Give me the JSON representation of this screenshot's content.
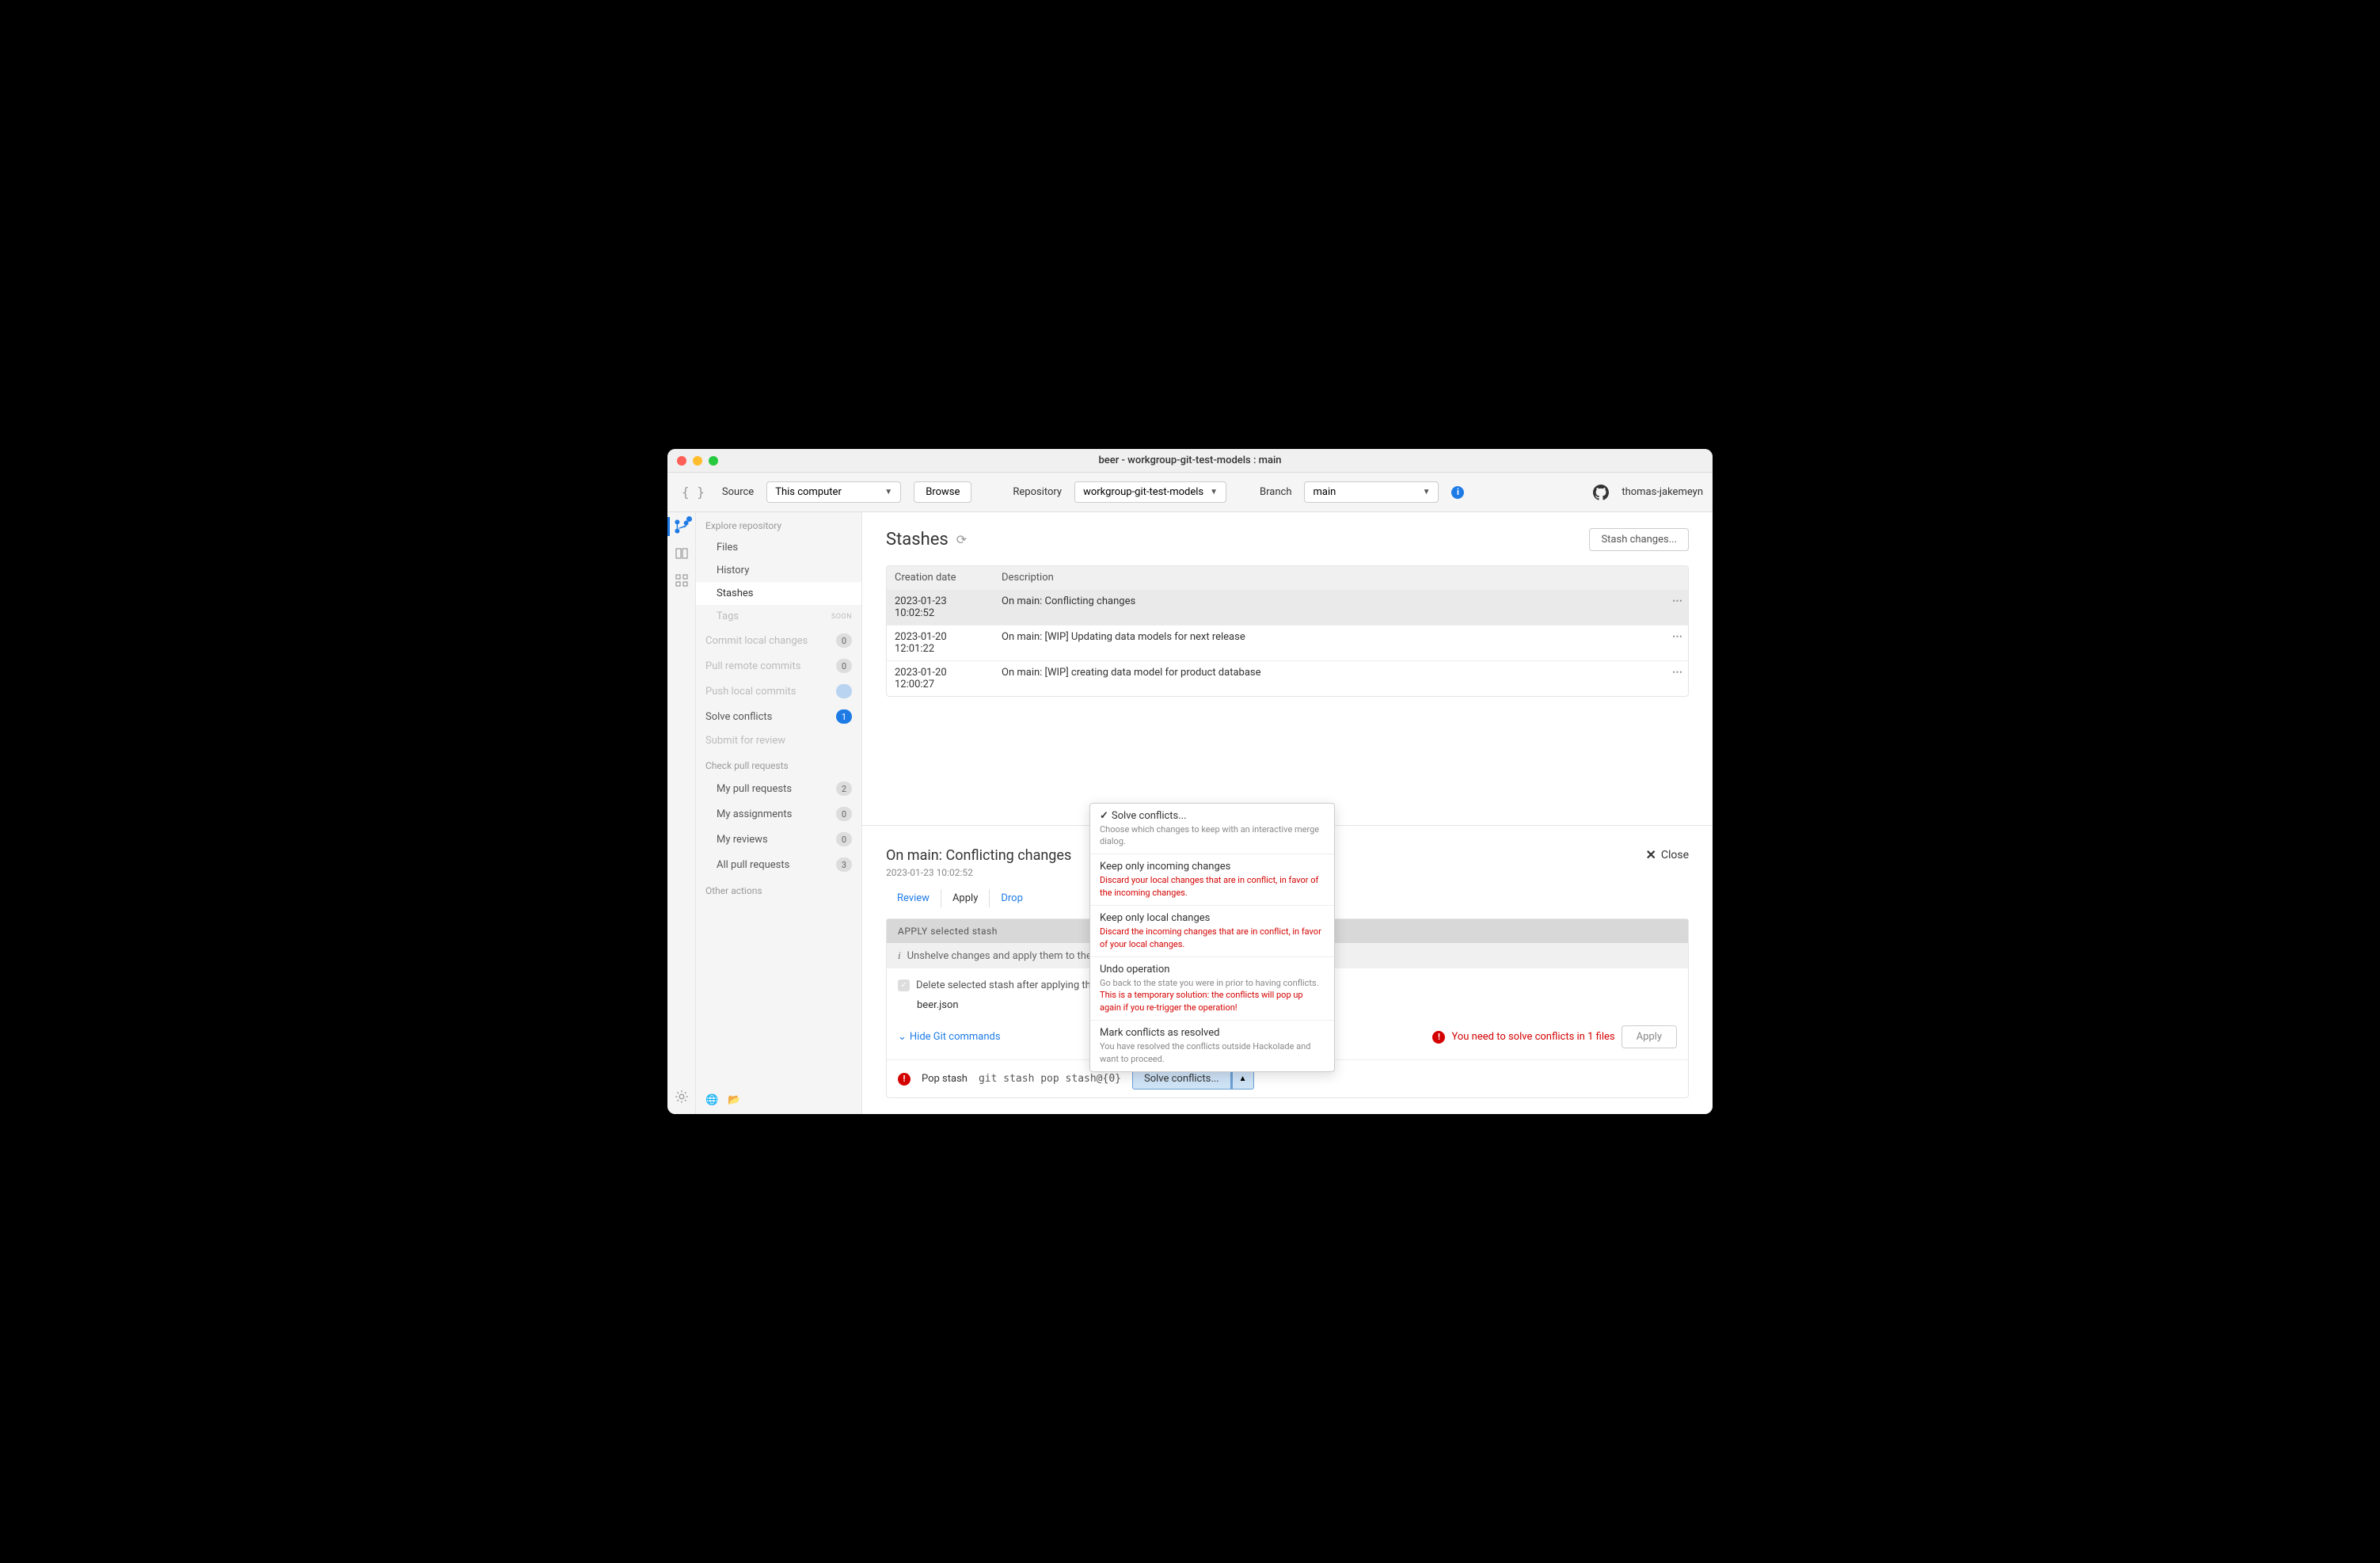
{
  "window": {
    "title": "beer - workgroup-git-test-models : main"
  },
  "toolbar": {
    "source_label": "Source",
    "source_value": "This computer",
    "browse": "Browse",
    "repo_label": "Repository",
    "repo_value": "workgroup-git-test-models",
    "branch_label": "Branch",
    "branch_value": "main",
    "username": "thomas-jakemeyn"
  },
  "sidebar": {
    "explore": "Explore repository",
    "files": "Files",
    "history": "History",
    "stashes": "Stashes",
    "tags": "Tags",
    "soon": "SOON",
    "commit": "Commit local changes",
    "commit_n": "0",
    "pull": "Pull remote commits",
    "pull_n": "0",
    "push": "Push local commits",
    "push_n": "",
    "solve": "Solve conflicts",
    "solve_n": "1",
    "submit": "Submit for review",
    "check": "Check pull requests",
    "my_pr": "My pull requests",
    "my_pr_n": "2",
    "my_asg": "My assignments",
    "my_asg_n": "0",
    "my_rev": "My reviews",
    "my_rev_n": "0",
    "all_pr": "All pull requests",
    "all_pr_n": "3",
    "other": "Other actions"
  },
  "main": {
    "title": "Stashes",
    "stash_btn": "Stash changes...",
    "col1": "Creation date",
    "col2": "Description",
    "rows": [
      {
        "date": "2023-01-23 10:02:52",
        "desc": "On main: Conflicting changes",
        "sel": true
      },
      {
        "date": "2023-01-20 12:01:22",
        "desc": "On main: [WIP] Updating data models for next release"
      },
      {
        "date": "2023-01-20 12:00:27",
        "desc": "On main: [WIP] creating data model for product database"
      }
    ]
  },
  "detail": {
    "title": "On main: Conflicting changes",
    "time": "2023-01-23 10:02:52",
    "close": "Close",
    "tab_review": "Review",
    "tab_apply": "Apply",
    "tab_drop": "Drop",
    "panel_head": "APPLY selected stash",
    "panel_info": "Unshelve changes and apply them to the active branch",
    "chk": "Delete selected stash after applying the changes",
    "file": "beer.json",
    "hide": "Hide Git commands",
    "pop": "Pop stash",
    "cmd": "git stash pop stash@{0}",
    "solve": "Solve conflicts...",
    "warn": "You need to solve conflicts in 1 files",
    "apply": "Apply"
  },
  "menu": {
    "i1": {
      "t": "Solve conflicts...",
      "d": "Choose which changes to keep with an interactive merge dialog."
    },
    "i2": {
      "t": "Keep only incoming changes",
      "d": "Discard your local changes that are in conflict, in favor of the incoming changes."
    },
    "i3": {
      "t": "Keep only local changes",
      "d": "Discard the incoming changes that are in conflict, in favor of your local changes."
    },
    "i4": {
      "t": "Undo operation",
      "d1": "Go back to the state you were in prior to having conflicts.",
      "d2": "This is a temporary solution: the conflicts will pop up again if you re-trigger the operation!"
    },
    "i5": {
      "t": "Mark conflicts as resolved",
      "d": "You have resolved the conflicts outside Hackolade and want to proceed."
    }
  }
}
